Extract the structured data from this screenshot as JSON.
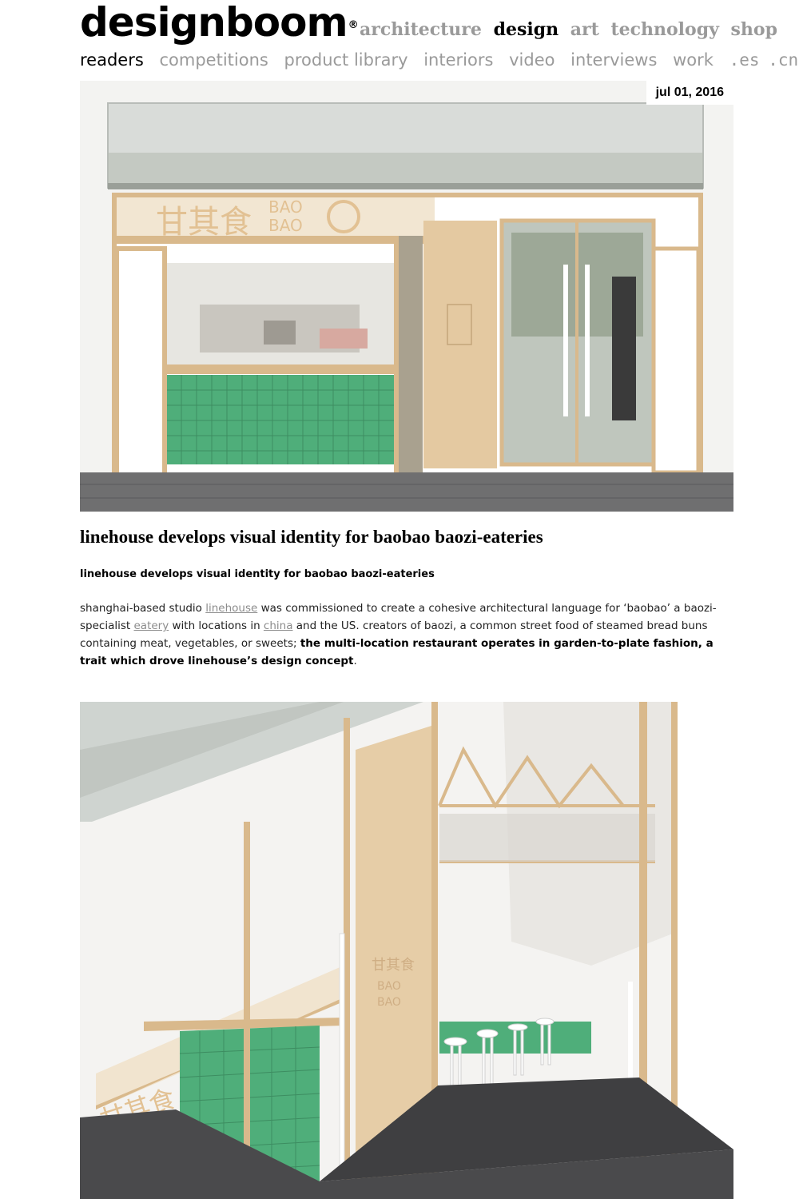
{
  "brand": {
    "name": "designboom",
    "registered_mark": "®"
  },
  "main_nav": [
    {
      "label": "architecture",
      "active": false
    },
    {
      "label": "design",
      "active": true
    },
    {
      "label": "art",
      "active": false
    },
    {
      "label": "technology",
      "active": false
    },
    {
      "label": "shop",
      "active": false
    }
  ],
  "sub_nav": [
    {
      "label": "readers",
      "active": true
    },
    {
      "label": "competitions",
      "active": false
    },
    {
      "label": "product library",
      "active": false
    },
    {
      "label": "interiors",
      "active": false
    },
    {
      "label": "video",
      "active": false
    },
    {
      "label": "interviews",
      "active": false
    },
    {
      "label": "work",
      "active": false
    },
    {
      "label": ".es",
      "active": false
    },
    {
      "label": ".cn",
      "active": false
    }
  ],
  "article": {
    "date": "jul 01, 2016",
    "headline": "linehouse develops visual identity for baobao baozi-eateries",
    "subheadline": "linehouse develops visual identity for baobao baozi-eateries",
    "body": {
      "p1": "shanghai-based studio ",
      "link1": "linehouse",
      "p2": " was commissioned to create a cohesive architectural language for ‘baobao’ a baozi-specialist ",
      "link2": "eatery",
      "p3": " with locations in ",
      "link3": "china",
      "p4": " and the US. creators of baozi, a common street food of steamed bread buns containing meat, vegetables, or sweets; ",
      "bold": "the multi-location restaurant operates in garden-to-plate fashion, a trait which drove linehouse’s design concept",
      "end": "."
    },
    "signage": {
      "chinese": "甘其食",
      "line1": "BAO",
      "line2": "BAO",
      "door_line1": "甘其食",
      "door_line2": "BAO",
      "door_line3": "BAO"
    }
  },
  "colors": {
    "nav_inactive": "#9a9a9a",
    "nav_active": "#000000",
    "link": "#8c8c8c",
    "wood": "#d9b98c",
    "tile_green": "#4fae7a"
  }
}
